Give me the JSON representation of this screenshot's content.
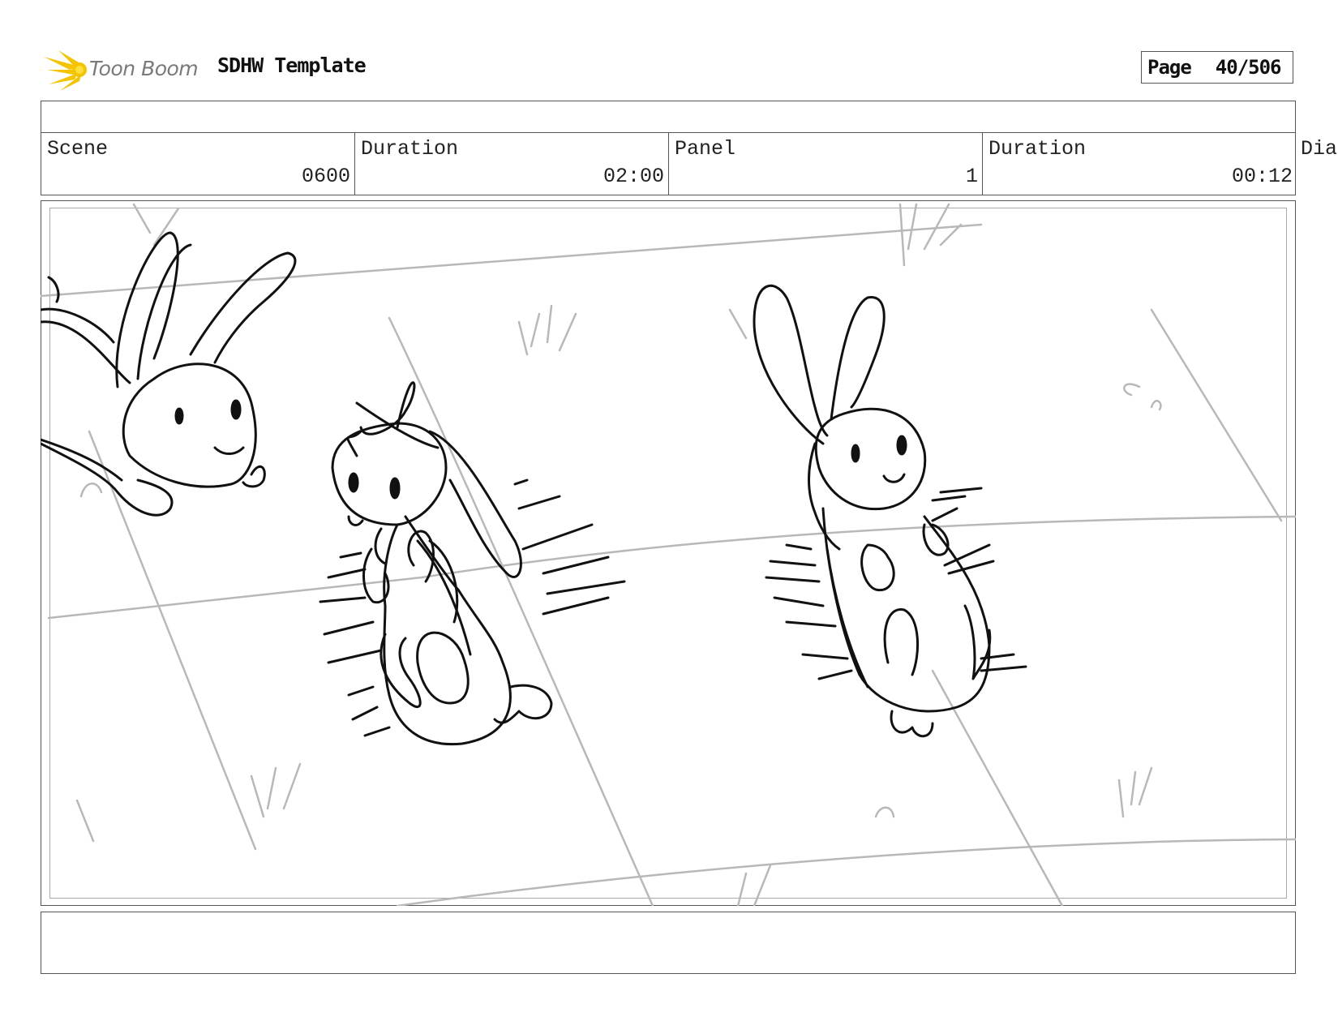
{
  "header": {
    "logo_icon": "toon-boom-logo",
    "brand": "Toon Boom",
    "title": "SDHW Template",
    "page_label": "Page",
    "page_value": "40/506"
  },
  "info": {
    "scene_label": "Scene",
    "scene_value": "0600",
    "duration_label": "Duration",
    "duration_value": "02:00",
    "panel_label": "Panel",
    "panel_value": "1",
    "panel_duration_label": "Duration",
    "panel_duration_value": "00:12",
    "dialogue_label": "Dia"
  },
  "colors": {
    "logo_accent": "#f5c400",
    "sketch_ink": "#111111",
    "guide_lines": "#b8b8b8"
  }
}
